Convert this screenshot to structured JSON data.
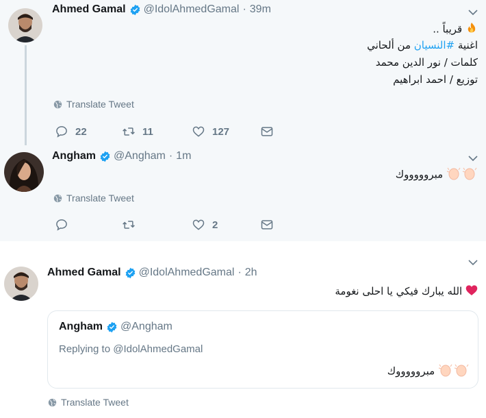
{
  "tweets": [
    {
      "author_name": "Ahmed Gamal",
      "handle": "@IdolAhmedGamal",
      "time": "39m",
      "lines": [
        "قريباً ..",
        "اغنية",
        "#النسيان",
        "من ألحاني",
        "كلمات / نور الدين محمد",
        "توزيع / احمد ابراهيم"
      ],
      "translate_label": "Translate Tweet",
      "reply_count": "22",
      "retweet_count": "11",
      "like_count": "127"
    },
    {
      "author_name": "Angham",
      "handle": "@Angham",
      "time": "1m",
      "text": "مبروووووك",
      "translate_label": "Translate Tweet",
      "reply_count": "",
      "retweet_count": "",
      "like_count": "2"
    },
    {
      "author_name": "Ahmed Gamal",
      "handle": "@IdolAhmedGamal",
      "time": "2h",
      "text": "الله يبارك فيكي يا احلى نغومة",
      "translate_label": "Translate Tweet",
      "quoted": {
        "author_name": "Angham",
        "handle": "@Angham",
        "replying_prefix": "Replying to",
        "replying_to": "@IdolAhmedGamal",
        "text": "مبروووووك"
      }
    }
  ],
  "separator": "·",
  "colors": {
    "verified": "#1da1f2",
    "hashtag": "#1da1f2",
    "muted": "#657786",
    "heart": "#e0245e"
  },
  "icons": [
    "verified-badge-icon",
    "caret-down-icon",
    "globe-icon",
    "reply-icon",
    "retweet-icon",
    "like-icon",
    "direct-message-icon",
    "fire-emoji-icon",
    "clapping-hands-emoji-icon",
    "red-heart-emoji-icon"
  ]
}
